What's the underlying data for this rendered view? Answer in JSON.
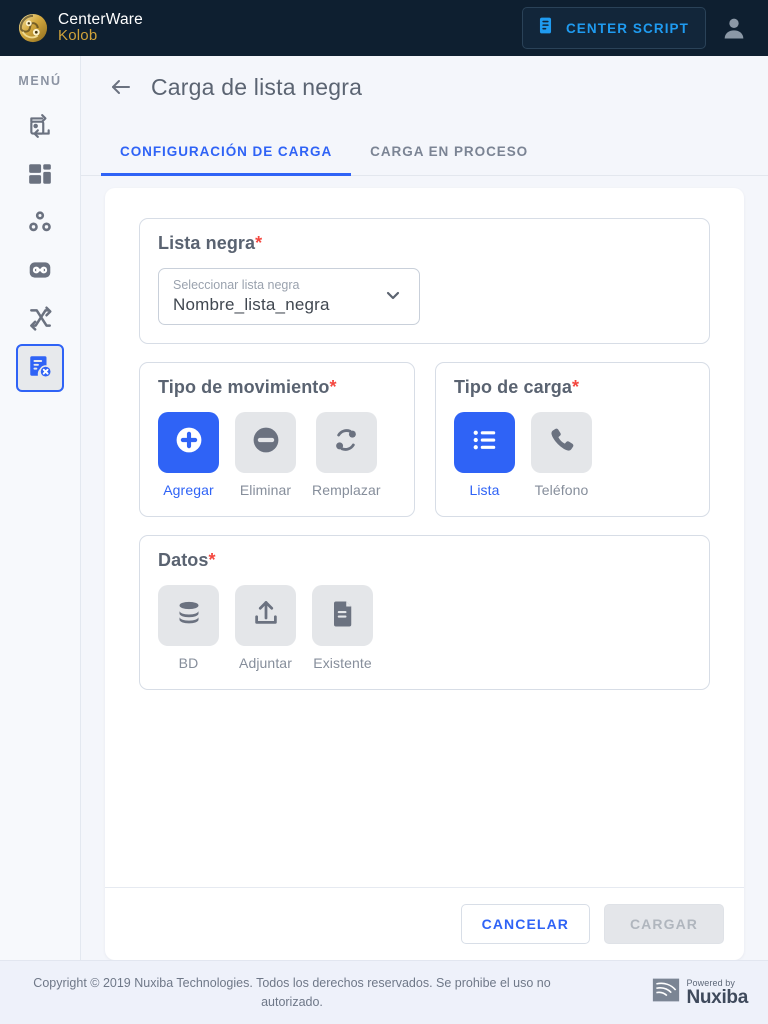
{
  "topbar": {
    "brand_title": "CenterWare",
    "brand_sub": "Kolob",
    "brand_icon": "nuxiba-swirl-logo",
    "center_script_label": "CENTER SCRIPT",
    "center_script_icon": "script-document-icon",
    "avatar_icon": "user-account-icon",
    "accent_color": "#1f9bf0",
    "background_color": "#0e1f30"
  },
  "sidebar": {
    "menu_label": "MENÚ",
    "items": [
      {
        "name": "campaign-transfer",
        "icon": "image-swap-icon",
        "active": false
      },
      {
        "name": "dashboard",
        "icon": "dashboard-grid-icon",
        "active": false
      },
      {
        "name": "agents",
        "icon": "three-circles-icon",
        "active": false
      },
      {
        "name": "voicemail",
        "icon": "voicemail-robot-icon",
        "active": false
      },
      {
        "name": "routing",
        "icon": "arrows-crossing-icon",
        "active": false
      },
      {
        "name": "blacklist-upload",
        "icon": "document-x-icon",
        "active": true
      }
    ]
  },
  "page": {
    "back_icon": "arrow-left-icon",
    "title": "Carga de lista negra",
    "tabs": [
      {
        "label": "CONFIGURACIÓN DE CARGA",
        "active": true
      },
      {
        "label": "CARGA EN PROCESO",
        "active": false
      }
    ]
  },
  "form": {
    "required_mark": "*",
    "blacklist": {
      "legend": "Lista negra",
      "select_placeholder": "Seleccionar lista negra",
      "select_value": "Nombre_lista_negra",
      "chevron_icon": "chevron-down-icon"
    },
    "movement_type": {
      "legend": "Tipo de movimiento",
      "options": [
        {
          "label": "Agregar",
          "icon": "plus-circle-icon",
          "selected": true
        },
        {
          "label": "Eliminar",
          "icon": "minus-circle-icon",
          "selected": false
        },
        {
          "label": "Remplazar",
          "icon": "replace-nodes-icon",
          "selected": false
        }
      ]
    },
    "load_type": {
      "legend": "Tipo de carga",
      "options": [
        {
          "label": "Lista",
          "icon": "bullet-list-icon",
          "selected": true
        },
        {
          "label": "Teléfono",
          "icon": "phone-icon",
          "selected": false
        }
      ]
    },
    "data_source": {
      "legend": "Datos",
      "options": [
        {
          "label": "BD",
          "icon": "database-icon",
          "selected": false
        },
        {
          "label": "Adjuntar",
          "icon": "upload-icon",
          "selected": false
        },
        {
          "label": "Existente",
          "icon": "file-document-icon",
          "selected": false
        }
      ]
    }
  },
  "actions": {
    "cancel_label": "CANCELAR",
    "load_label": "CARGAR",
    "load_disabled": true,
    "primary_color": "#2f63f6"
  },
  "footer": {
    "copyright": "Copyright © 2019 Nuxiba Technologies. Todos los derechos reservados. Se prohibe el uso no autorizado.",
    "powered_by": "Powered by",
    "powered_brand": "Nuxiba",
    "powered_icon": "nuxiba-wave-icon"
  }
}
